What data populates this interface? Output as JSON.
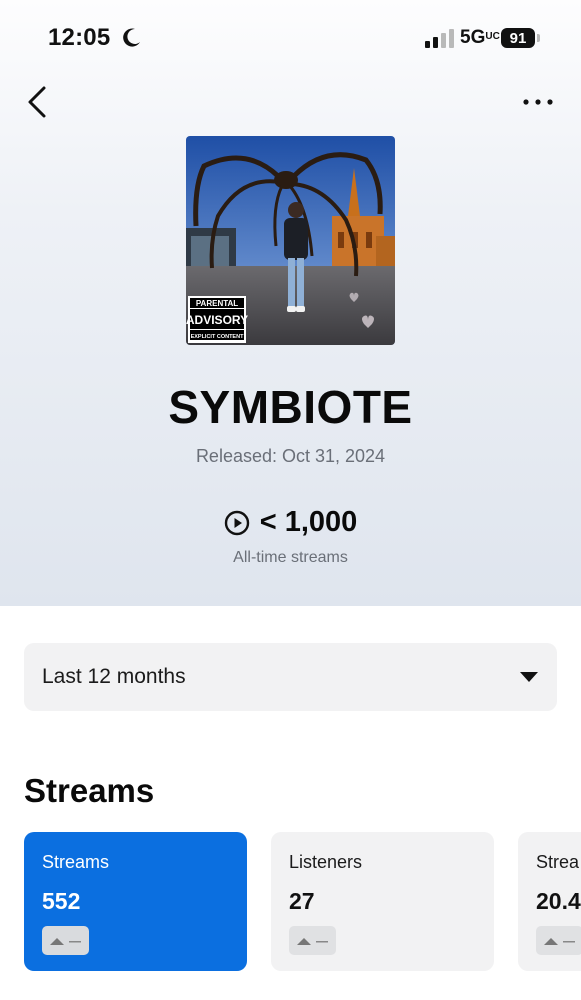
{
  "status_bar": {
    "time": "12:05",
    "network": "5G",
    "network_suffix": "UC",
    "battery": "91"
  },
  "icons": {
    "back": "chevron-left-icon",
    "more": "more-horizontal-icon",
    "moon": "moon-icon",
    "signal": "signal-bars-icon",
    "play": "play-circle-icon",
    "caret": "caret-down-icon",
    "trend": "trend-up-icon"
  },
  "release": {
    "title": "SYMBIOTE",
    "released": "Released: Oct 31, 2024",
    "all_time_streams": "< 1,000",
    "all_time_label": "All-time streams",
    "cover_badge": [
      "PARENTAL",
      "ADVISORY",
      "EXPLICIT CONTENT"
    ]
  },
  "filter": {
    "selected": "Last 12 months"
  },
  "section": {
    "title": "Streams"
  },
  "cards": [
    {
      "label": "Streams",
      "value": "552",
      "active": true
    },
    {
      "label": "Listeners",
      "value": "27",
      "active": false
    },
    {
      "label": "Strea",
      "value": "20.4",
      "active": false
    }
  ],
  "colors": {
    "accent": "#0b6fe0",
    "card_bg": "#f2f2f3",
    "secondary_text": "#6a6f78"
  }
}
